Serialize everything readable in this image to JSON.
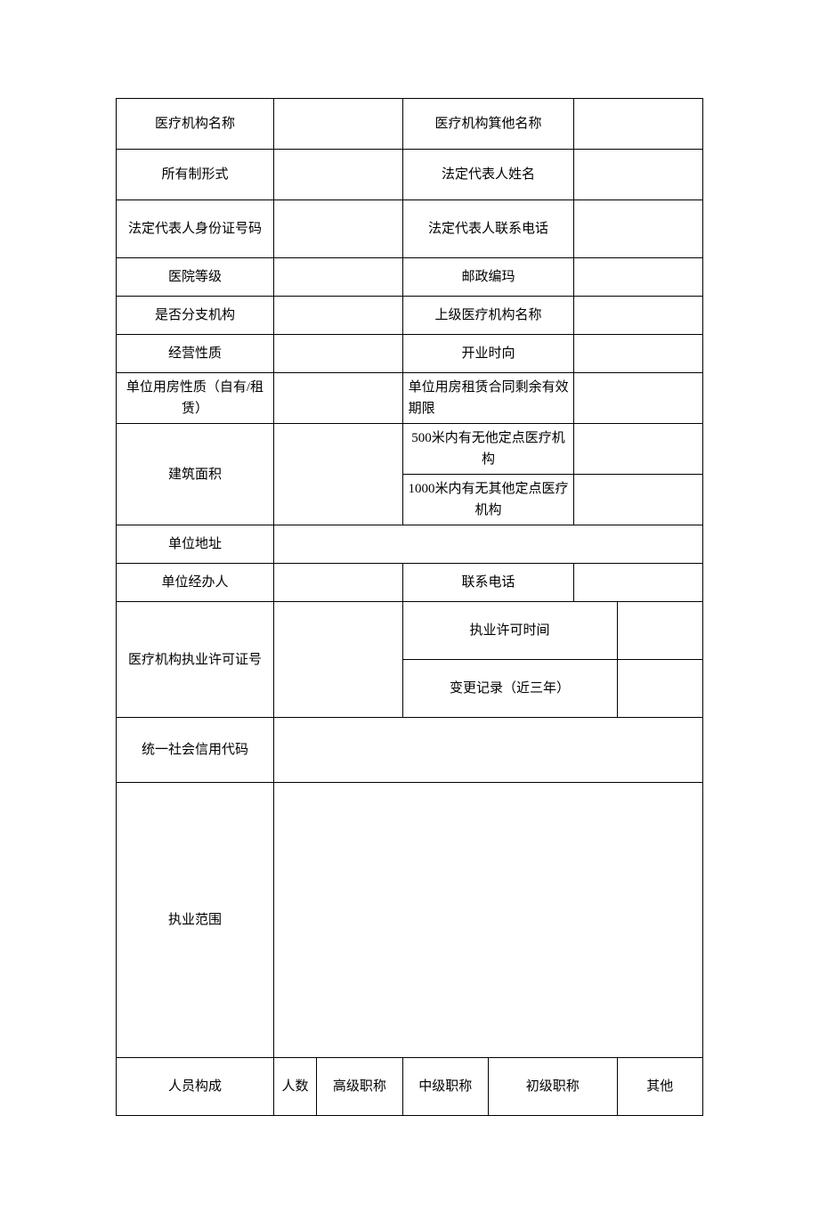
{
  "rows": {
    "r1": {
      "l": "医疗机构名称",
      "r": "医疗机构箕他名称"
    },
    "r2": {
      "l": "所有制形式",
      "r": "法定代表人姓名"
    },
    "r3": {
      "l": "法定代表人身份证号码",
      "r": "法定代表人联系电话"
    },
    "r4": {
      "l": "医院等级",
      "r": "邮政编玛"
    },
    "r5": {
      "l": "是否分支机构",
      "r": "上级医疗机构名称"
    },
    "r6": {
      "l": "经营性质",
      "r": "开业时向"
    },
    "r7": {
      "l": "单位用房性质（自有/租赁）",
      "r": "单位用房租赁合同剩余有效期限"
    },
    "r8": {
      "l": "建筑面积",
      "a": "500米内有无他定点医疗机构",
      "b": "1000米内有无其他定点医疗机构"
    },
    "r9": {
      "l": "单位地址"
    },
    "r10": {
      "l": "单位经办人",
      "r": "联系电话"
    },
    "r11": {
      "l": "医疗机构执业许可证号",
      "a": "执业许可时间",
      "b": "变更记录（近三年）"
    },
    "r12": {
      "l": "统一社会信用代码"
    },
    "r13": {
      "l": "执业范围"
    },
    "r14": {
      "l": "人员构成",
      "c1": "人数",
      "c2": "高级职称",
      "c3": "中级职称",
      "c4": "初级职称",
      "c5": "其他"
    }
  }
}
